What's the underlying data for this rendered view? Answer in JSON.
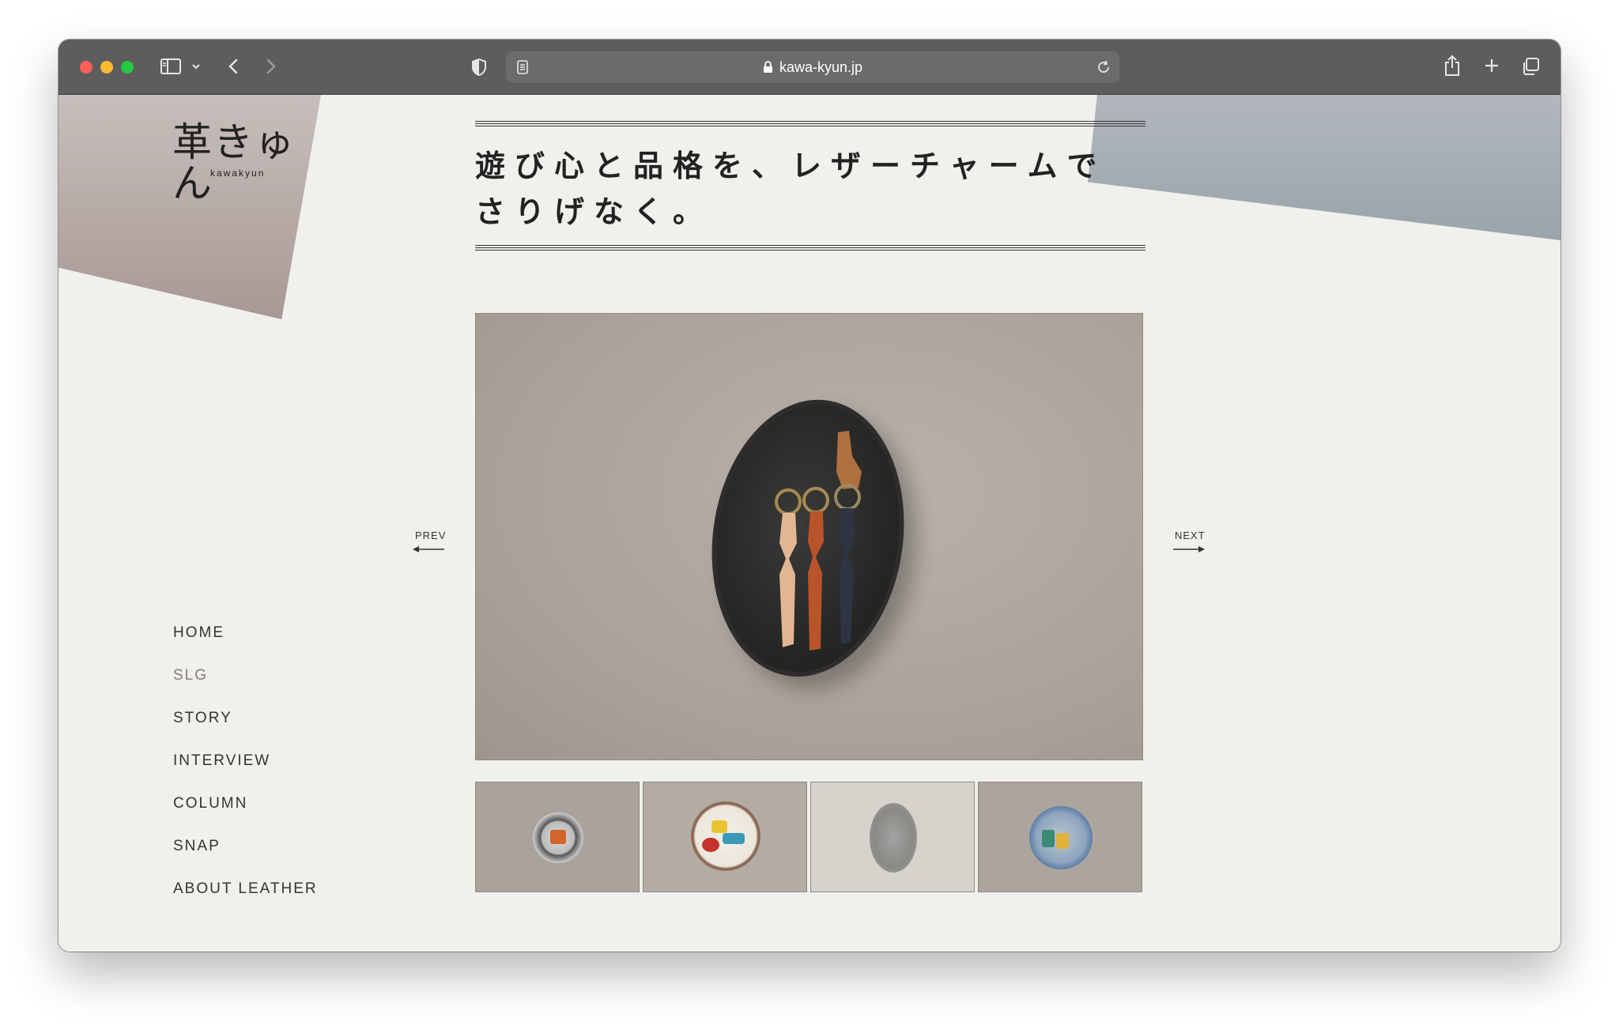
{
  "browser": {
    "url": "kawa-kyun.jp",
    "colors": {
      "toolbar": "#5d5d5d",
      "urlbar": "#6b6b6b",
      "close": "#fe5f57",
      "minimize": "#febc2e",
      "zoom": "#28c840"
    }
  },
  "logo": {
    "main": "革きゅん",
    "sub": "kawakyun"
  },
  "headline": "遊び心と品格を、レザーチャームでさりげなく。",
  "slider": {
    "prev_label": "PREV",
    "next_label": "NEXT",
    "thumbnail_count": 4,
    "active_thumbnail": 3
  },
  "nav": {
    "items": [
      {
        "label": "HOME",
        "active": false
      },
      {
        "label": "SLG",
        "active": true
      },
      {
        "label": "STORY",
        "active": false
      },
      {
        "label": "INTERVIEW",
        "active": false
      },
      {
        "label": "COLUMN",
        "active": false
      },
      {
        "label": "SNAP",
        "active": false
      },
      {
        "label": "ABOUT LEATHER",
        "active": false
      }
    ]
  },
  "colors": {
    "page_bg": "#f0f0ec",
    "active_nav": "#8a7c73",
    "text": "#333333"
  }
}
